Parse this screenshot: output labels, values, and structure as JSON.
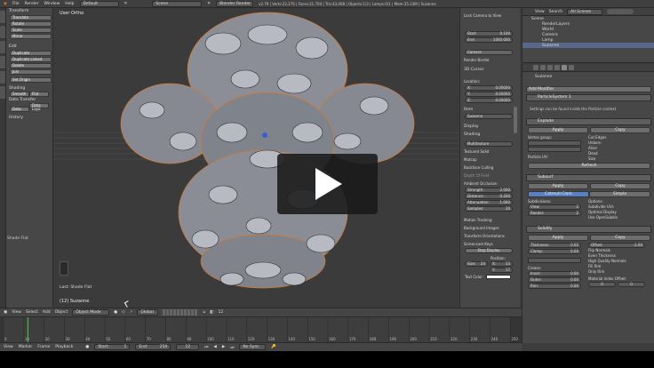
{
  "topbar": {
    "menus": [
      "File",
      "Render",
      "Window",
      "Help"
    ],
    "layout": "Default",
    "scene": "Scene",
    "engine": "Blender Render",
    "stats": "v2.79 | Verts:22,276 | Faces:21,704 | Tris:43,408 | Objects:1/3 | Lamps:0/1 | Mem:35.23M | Suzanne"
  },
  "toolshelf": {
    "transform_header": "Transform",
    "transform_buttons": [
      "Translate",
      "Rotate",
      "Scale",
      "Mirror"
    ],
    "edit_header": "Edit",
    "edit_buttons": [
      "Duplicate",
      "Duplicate Linked",
      "Delete",
      "Join"
    ],
    "set_origin": "Set Origin",
    "shading_header": "Shading",
    "smooth": "Smooth",
    "flat": "Flat",
    "data_transfer_header": "Data Transfer",
    "data": "Data",
    "data_layout": "Data Layo",
    "history_header": "History",
    "last_op": "Shade Flat"
  },
  "viewport": {
    "label": "User Ortho",
    "object_name": "(12) Suzanne"
  },
  "opbox": {
    "title": "Last: Shade Flat"
  },
  "npanel": {
    "lock_camera": "Lock Camera to View",
    "start": "Start",
    "start_val": "0.100",
    "end": "End",
    "end_val": "1000.000",
    "camera": "Camera",
    "render_border": "Render Border",
    "cursor_header": "3D Cursor",
    "location": "Location:",
    "x": "X:",
    "x_val": "0.00000",
    "y": "Y:",
    "y_val": "0.00000",
    "z": "Z:",
    "z_val": "0.00000",
    "item_header": "Item",
    "item_name": "Suzanne",
    "display_header": "Display",
    "shading_header": "Shading",
    "multitexture": "Multitexture",
    "textured_solid": "Textured Solid",
    "matcap": "Matcap",
    "backface_culling": "Backface Culling",
    "depth_of_field": "Depth Of Field",
    "ambient_occlusion": "Ambient Occlusion",
    "strength": "Strength:",
    "strength_val": "2.000",
    "distance": "Distance:",
    "distance_val": "0.200",
    "attenuation": "Attenuation:",
    "attenuation_val": "1.000",
    "samples": "Samples:",
    "samples_val": "20",
    "motion_tracking": "Motion Tracking",
    "background_images": "Background Images",
    "transform_orientations": "Transform Orientations",
    "screencast_keys": "Screencast Keys",
    "stop_display": "Stop Display",
    "position": "Position:",
    "size": "Size:",
    "size_val": "24",
    "xpos": "X:",
    "xpos_val": "13",
    "ypos": "Y:",
    "ypos_val": "17",
    "text_color": "Text Color:"
  },
  "outliner": {
    "view": "View",
    "search": "Search",
    "all_scenes": "All Scenes",
    "items": [
      "Scene",
      "RenderLayers",
      "World",
      "Camera",
      "Lamp",
      "Suzanne"
    ]
  },
  "props": {
    "object_name": "Suzanne",
    "add_modifier": "Add Modifier",
    "m1_name": "ParticleSystem 1",
    "m1_note": "Settings can be found inside the Particle context",
    "m2_name": "Explode",
    "apply": "Apply",
    "copy": "Copy",
    "vertex_group": "Vertex group:",
    "cut_edges": "Cut Edges",
    "unborn": "Unborn",
    "alive": "Alive",
    "dead": "Dead",
    "size": "Size",
    "particle_uv": "Particle UV:",
    "refresh": "Refresh",
    "m3_name": "Subsurf",
    "catmull": "Catmull-Clark",
    "simple": "Simple",
    "subdivisions": "Subdivisions:",
    "view_lbl": "View:",
    "view_val": "2",
    "render_lbl": "Render:",
    "render_val": "2",
    "options": "Options:",
    "subdivide_uvs": "Subdivide UVs",
    "optimal_display": "Optimal Display",
    "use_opensubdiv": "Use OpenSubdiv",
    "m4_name": "Solidify",
    "thickness": "Thickness:",
    "thickness_val": "0.02",
    "clamp": "Clamp:",
    "clamp_val": "0.00",
    "offset": "Offset:",
    "offset_val": "-1.00",
    "flip_normals": "Flip Normals",
    "even_thickness": "Even Thickness",
    "high_quality_normals": "High Quality Normals",
    "fill_rim": "Fill Rim",
    "only_rim": "Only Rim",
    "crease": "Crease:",
    "inner": "Inner:",
    "outer": "Outer:",
    "rim": "Rim:",
    "zero": "0.00",
    "material_index": "Material Index Offset:",
    "mi_val": "0",
    "rim_val": "0"
  },
  "hdr3d": {
    "menus": [
      "View",
      "Select",
      "Add",
      "Object"
    ],
    "mode": "Object Mode",
    "orientation": "Global",
    "layers": "12"
  },
  "timeline": {
    "ticks": [
      "0",
      "10",
      "20",
      "30",
      "40",
      "50",
      "60",
      "70",
      "80",
      "90",
      "100",
      "110",
      "120",
      "130",
      "140",
      "150",
      "160",
      "170",
      "180",
      "190",
      "200",
      "210",
      "220",
      "230",
      "240",
      "250"
    ],
    "current_frame": 12,
    "frame_end": 250
  },
  "tlfooter": {
    "menus": [
      "View",
      "Marker",
      "Frame",
      "Playback"
    ],
    "start": "Start:",
    "start_val": "1",
    "end": "End:",
    "end_val": "250",
    "frame_val": "12",
    "sync": "No Sync"
  }
}
